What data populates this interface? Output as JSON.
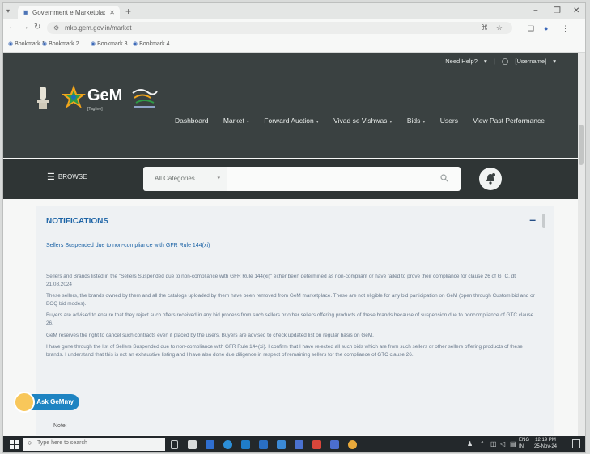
{
  "browser": {
    "tab_title": "Government e Marketplace",
    "url": "mkp.gem.gov.in/market",
    "bookmarks": [
      "Bookmark 1",
      "Bookmark 2",
      "Bookmark 3",
      "Bookmark 4"
    ]
  },
  "header": {
    "top_links": {
      "need_help": "Need Help?",
      "user": "[Username]"
    },
    "brand": {
      "name": "GeM",
      "tagline": "[Tagline]"
    },
    "nav": [
      "Dashboard",
      "Market",
      "Forward Auction",
      "Vivad se Vishwas",
      "Bids",
      "Users",
      "View Past Performance"
    ],
    "browse_label": "BROWSE",
    "category_value": "All Categories",
    "search_placeholder": ""
  },
  "notifications": {
    "title": "NOTIFICATIONS",
    "heading": "Sellers Suspended due to non-compliance with GFR Rule 144(xi)",
    "paragraphs": [
      "Sellers and Brands listed in the \"Sellers Suspended due to non-compliance with GFR Rule 144(xi)\" either been determined as non-compliant or have failed to prove their compliance for clause 26 of GTC, dt 21.08.2024",
      "These sellers, the brands owned by them and all the catalogs uploaded by them have been removed from GeM marketplace. These are not eligible for any bid participation on GeM (open through Custom bid and or BOQ bid modes).",
      "Buyers are advised to ensure that they reject such offers received in any bid process from such sellers or other sellers offering products of these brands because of suspension due to noncompliance of GTC clause 26.",
      "GeM reserves the right to cancel such contracts even if placed by the users. Buyers are advised to check updated list on regular basis on GeM.",
      "I have gone through the list of Sellers Suspended due to non-compliance with GFR Rule 144(xi). I confirm that I have rejected all such bids which are from such sellers or other sellers offering products of these brands. I understand that this is not an exhaustive listing and I have also done due diligence in respect of remaining sellers for the compliance of GTC clause 26."
    ],
    "note_label": "Note:"
  },
  "assistant": {
    "label": "Ask GeMmy"
  },
  "taskbar": {
    "search_placeholder": "Type here to search",
    "lang_line1": "ENG",
    "lang_line2": "IN",
    "time": "12:19 PM",
    "date": "25-Nov-24"
  },
  "colors": {
    "header_bg": "#3a4141",
    "search_row_bg": "#2f3535",
    "link_blue": "#1d64a6",
    "assistant_blue": "#1e84c2"
  }
}
